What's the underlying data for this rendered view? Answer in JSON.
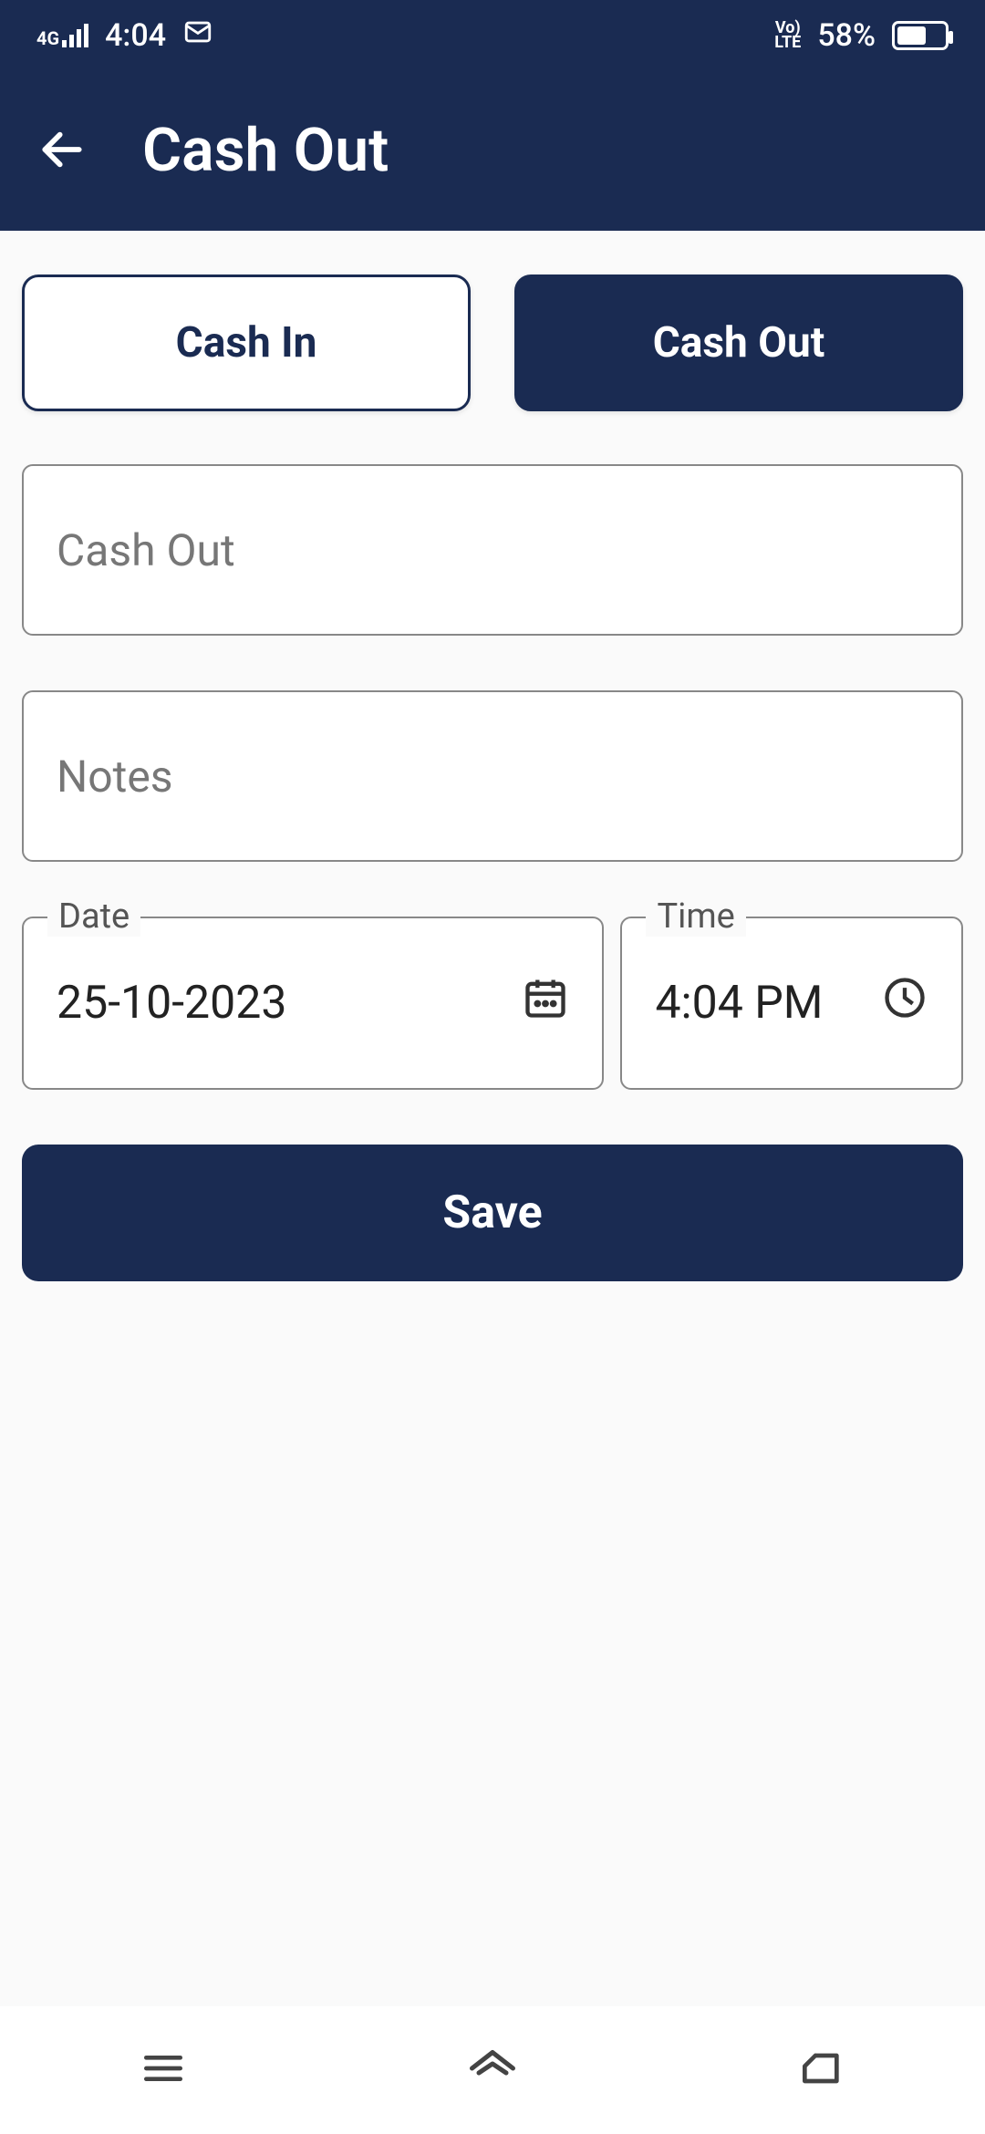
{
  "statusbar": {
    "network": "4G",
    "time": "4:04",
    "volte_top": "Vo)",
    "volte_bottom": "LTE",
    "battery": "58%"
  },
  "appbar": {
    "title": "Cash Out"
  },
  "toggles": {
    "cash_in": "Cash In",
    "cash_out": "Cash Out"
  },
  "fields": {
    "amount_placeholder": "Cash Out",
    "notes_placeholder": "Notes",
    "date_label": "Date",
    "date_value": "25-10-2023",
    "time_label": "Time",
    "time_value": "4:04 PM"
  },
  "actions": {
    "save": "Save"
  }
}
